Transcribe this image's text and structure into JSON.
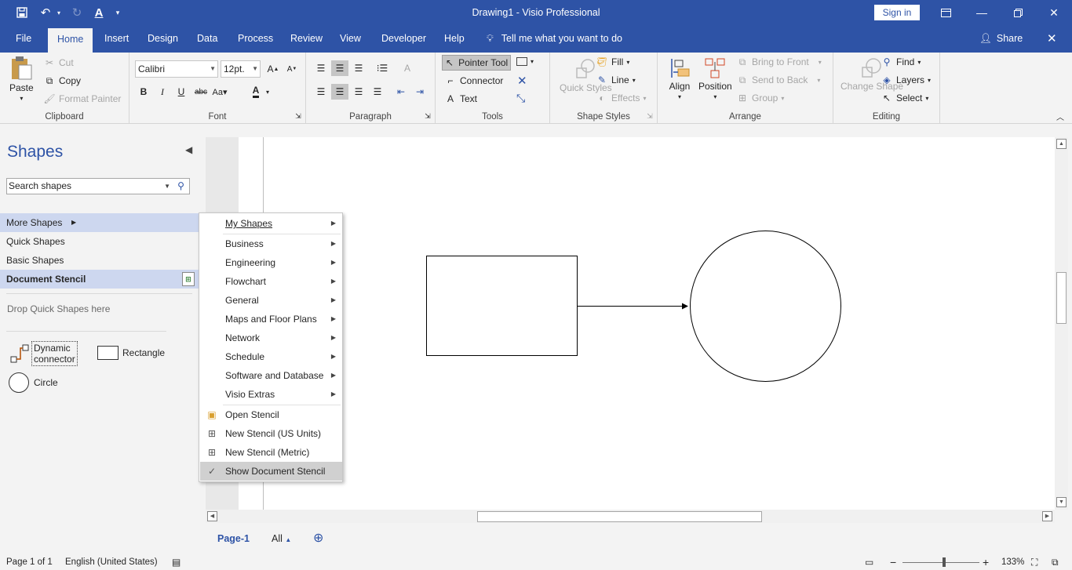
{
  "app": {
    "title": "Drawing1  -  Visio Professional",
    "sign_in": "Sign in",
    "share": "Share",
    "tell_me": "Tell me what you want to do"
  },
  "tabs": [
    "File",
    "Home",
    "Insert",
    "Design",
    "Data",
    "Process",
    "Review",
    "View",
    "Developer",
    "Help"
  ],
  "active_tab": "Home",
  "ribbon": {
    "clipboard": {
      "label": "Clipboard",
      "paste": "Paste",
      "cut": "Cut",
      "copy": "Copy",
      "format_painter": "Format Painter"
    },
    "font": {
      "label": "Font",
      "family": "Calibri",
      "size": "12pt."
    },
    "paragraph": {
      "label": "Paragraph"
    },
    "tools": {
      "label": "Tools",
      "pointer": "Pointer Tool",
      "connector": "Connector",
      "text": "Text"
    },
    "shape_styles": {
      "label": "Shape Styles",
      "quick_styles": "Quick Styles",
      "fill": "Fill",
      "line": "Line",
      "effects": "Effects"
    },
    "arrange": {
      "label": "Arrange",
      "align": "Align",
      "position": "Position",
      "bring_front": "Bring to Front",
      "send_back": "Send to Back",
      "group": "Group"
    },
    "editing": {
      "label": "Editing",
      "change_shape": "Change Shape",
      "find": "Find",
      "layers": "Layers",
      "select": "Select"
    }
  },
  "shapes_pane": {
    "title": "Shapes",
    "search_placeholder": "Search shapes",
    "items": [
      "More Shapes",
      "Quick Shapes",
      "Basic Shapes",
      "Document Stencil"
    ],
    "drop_note": "Drop Quick Shapes here",
    "stencil": {
      "dynamic_connector": "Dynamic connector",
      "rectangle": "Rectangle",
      "circle": "Circle"
    }
  },
  "more_shapes_menu": {
    "submenus": [
      "My Shapes",
      "Business",
      "Engineering",
      "Flowchart",
      "General",
      "Maps and Floor Plans",
      "Network",
      "Schedule",
      "Software and Database",
      "Visio Extras"
    ],
    "actions": [
      "Open Stencil",
      "New Stencil (US Units)",
      "New Stencil (Metric)",
      "Show Document Stencil"
    ],
    "checked": "Show Document Stencil"
  },
  "page_tabs": {
    "page": "Page-1",
    "all": "All"
  },
  "status": {
    "page": "Page 1 of 1",
    "language": "English (United States)",
    "zoom": "133%"
  },
  "colors": {
    "brand": "#2e53a6",
    "ribbon_bg": "#f3f3f3",
    "selection": "#cdd7ef"
  }
}
